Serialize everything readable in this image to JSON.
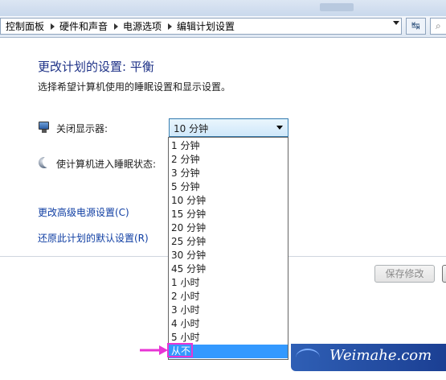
{
  "breadcrumb": {
    "items": [
      "控制面板",
      "硬件和声音",
      "电源选项",
      "编辑计划设置"
    ]
  },
  "heading": {
    "title": "更改计划的设置: 平衡",
    "description": "选择希望计算机使用的睡眠设置和显示设置。"
  },
  "settings": {
    "display_label": "关闭显示器:",
    "sleep_label": "使计算机进入睡眠状态:",
    "display_value": "10 分钟"
  },
  "dropdown": {
    "options": [
      "1 分钟",
      "2 分钟",
      "3 分钟",
      "5 分钟",
      "10 分钟",
      "15 分钟",
      "20 分钟",
      "25 分钟",
      "30 分钟",
      "45 分钟",
      "1 小时",
      "2 小时",
      "3 小时",
      "4 小时",
      "5 小时",
      "从不"
    ],
    "highlighted": "从不"
  },
  "links": {
    "advanced": "更改高级电源设置(C)",
    "restore": "还原此计划的默认设置(R)"
  },
  "buttons": {
    "save": "保存修改"
  },
  "watermark": {
    "text": "Weimahe.com"
  },
  "colors": {
    "title": "#1e3287",
    "link": "#0f3ea3",
    "selection": "#3399ff",
    "annotation": "#e834d4"
  },
  "icons": {
    "display": "monitor-icon",
    "sleep": "moon-icon",
    "refresh": "refresh-icon"
  }
}
